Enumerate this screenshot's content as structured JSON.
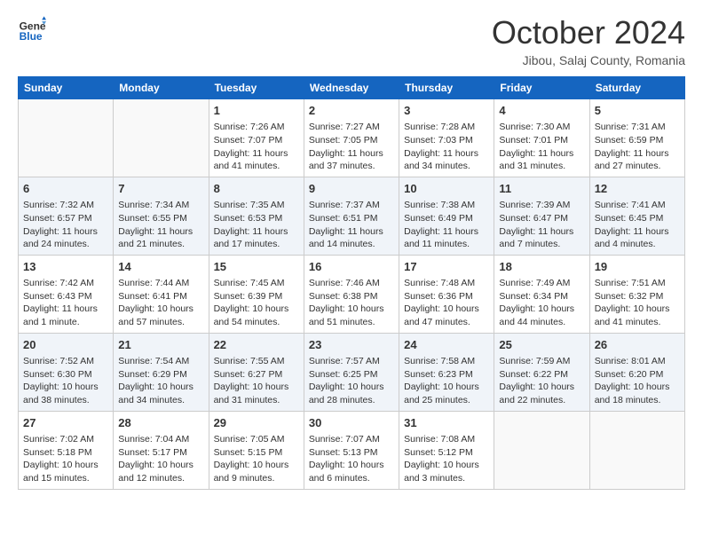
{
  "header": {
    "logo_general": "General",
    "logo_blue": "Blue",
    "month_title": "October 2024",
    "location": "Jibou, Salaj County, Romania"
  },
  "weekdays": [
    "Sunday",
    "Monday",
    "Tuesday",
    "Wednesday",
    "Thursday",
    "Friday",
    "Saturday"
  ],
  "weeks": [
    [
      {
        "day": "",
        "info": ""
      },
      {
        "day": "",
        "info": ""
      },
      {
        "day": "1",
        "info": "Sunrise: 7:26 AM\nSunset: 7:07 PM\nDaylight: 11 hours and 41 minutes."
      },
      {
        "day": "2",
        "info": "Sunrise: 7:27 AM\nSunset: 7:05 PM\nDaylight: 11 hours and 37 minutes."
      },
      {
        "day": "3",
        "info": "Sunrise: 7:28 AM\nSunset: 7:03 PM\nDaylight: 11 hours and 34 minutes."
      },
      {
        "day": "4",
        "info": "Sunrise: 7:30 AM\nSunset: 7:01 PM\nDaylight: 11 hours and 31 minutes."
      },
      {
        "day": "5",
        "info": "Sunrise: 7:31 AM\nSunset: 6:59 PM\nDaylight: 11 hours and 27 minutes."
      }
    ],
    [
      {
        "day": "6",
        "info": "Sunrise: 7:32 AM\nSunset: 6:57 PM\nDaylight: 11 hours and 24 minutes."
      },
      {
        "day": "7",
        "info": "Sunrise: 7:34 AM\nSunset: 6:55 PM\nDaylight: 11 hours and 21 minutes."
      },
      {
        "day": "8",
        "info": "Sunrise: 7:35 AM\nSunset: 6:53 PM\nDaylight: 11 hours and 17 minutes."
      },
      {
        "day": "9",
        "info": "Sunrise: 7:37 AM\nSunset: 6:51 PM\nDaylight: 11 hours and 14 minutes."
      },
      {
        "day": "10",
        "info": "Sunrise: 7:38 AM\nSunset: 6:49 PM\nDaylight: 11 hours and 11 minutes."
      },
      {
        "day": "11",
        "info": "Sunrise: 7:39 AM\nSunset: 6:47 PM\nDaylight: 11 hours and 7 minutes."
      },
      {
        "day": "12",
        "info": "Sunrise: 7:41 AM\nSunset: 6:45 PM\nDaylight: 11 hours and 4 minutes."
      }
    ],
    [
      {
        "day": "13",
        "info": "Sunrise: 7:42 AM\nSunset: 6:43 PM\nDaylight: 11 hours and 1 minute."
      },
      {
        "day": "14",
        "info": "Sunrise: 7:44 AM\nSunset: 6:41 PM\nDaylight: 10 hours and 57 minutes."
      },
      {
        "day": "15",
        "info": "Sunrise: 7:45 AM\nSunset: 6:39 PM\nDaylight: 10 hours and 54 minutes."
      },
      {
        "day": "16",
        "info": "Sunrise: 7:46 AM\nSunset: 6:38 PM\nDaylight: 10 hours and 51 minutes."
      },
      {
        "day": "17",
        "info": "Sunrise: 7:48 AM\nSunset: 6:36 PM\nDaylight: 10 hours and 47 minutes."
      },
      {
        "day": "18",
        "info": "Sunrise: 7:49 AM\nSunset: 6:34 PM\nDaylight: 10 hours and 44 minutes."
      },
      {
        "day": "19",
        "info": "Sunrise: 7:51 AM\nSunset: 6:32 PM\nDaylight: 10 hours and 41 minutes."
      }
    ],
    [
      {
        "day": "20",
        "info": "Sunrise: 7:52 AM\nSunset: 6:30 PM\nDaylight: 10 hours and 38 minutes."
      },
      {
        "day": "21",
        "info": "Sunrise: 7:54 AM\nSunset: 6:29 PM\nDaylight: 10 hours and 34 minutes."
      },
      {
        "day": "22",
        "info": "Sunrise: 7:55 AM\nSunset: 6:27 PM\nDaylight: 10 hours and 31 minutes."
      },
      {
        "day": "23",
        "info": "Sunrise: 7:57 AM\nSunset: 6:25 PM\nDaylight: 10 hours and 28 minutes."
      },
      {
        "day": "24",
        "info": "Sunrise: 7:58 AM\nSunset: 6:23 PM\nDaylight: 10 hours and 25 minutes."
      },
      {
        "day": "25",
        "info": "Sunrise: 7:59 AM\nSunset: 6:22 PM\nDaylight: 10 hours and 22 minutes."
      },
      {
        "day": "26",
        "info": "Sunrise: 8:01 AM\nSunset: 6:20 PM\nDaylight: 10 hours and 18 minutes."
      }
    ],
    [
      {
        "day": "27",
        "info": "Sunrise: 7:02 AM\nSunset: 5:18 PM\nDaylight: 10 hours and 15 minutes."
      },
      {
        "day": "28",
        "info": "Sunrise: 7:04 AM\nSunset: 5:17 PM\nDaylight: 10 hours and 12 minutes."
      },
      {
        "day": "29",
        "info": "Sunrise: 7:05 AM\nSunset: 5:15 PM\nDaylight: 10 hours and 9 minutes."
      },
      {
        "day": "30",
        "info": "Sunrise: 7:07 AM\nSunset: 5:13 PM\nDaylight: 10 hours and 6 minutes."
      },
      {
        "day": "31",
        "info": "Sunrise: 7:08 AM\nSunset: 5:12 PM\nDaylight: 10 hours and 3 minutes."
      },
      {
        "day": "",
        "info": ""
      },
      {
        "day": "",
        "info": ""
      }
    ]
  ]
}
